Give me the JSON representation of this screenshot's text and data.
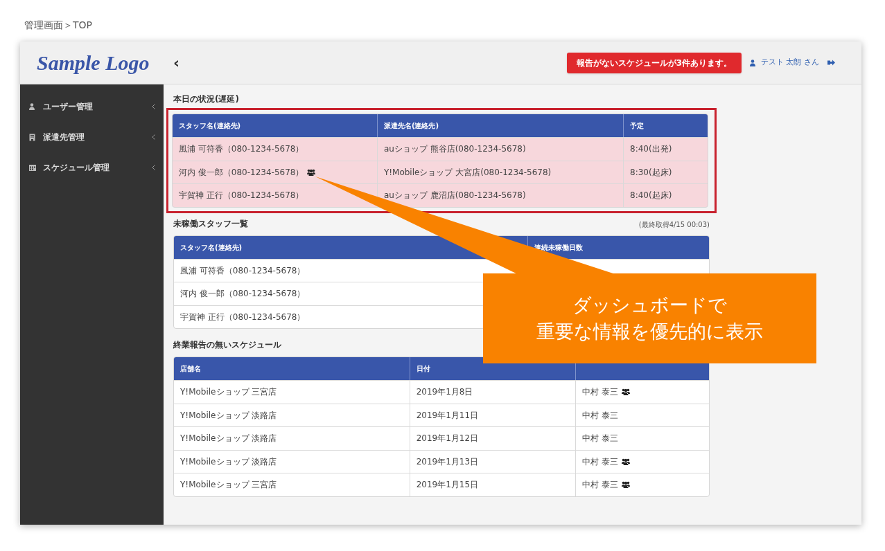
{
  "breadcrumb": "管理画面＞TOP",
  "header": {
    "logo": "Sample Logo",
    "toggle": "‹",
    "alert": "報告がないスケジュールが3件あります。",
    "user": "テスト 太朗 さん"
  },
  "sidebar": {
    "items": [
      {
        "label": "ユーザー管理"
      },
      {
        "label": "派遣先管理"
      },
      {
        "label": "スケジュール管理"
      }
    ]
  },
  "sections": [
    {
      "title": "本日の状況(遅延)",
      "highlighted": true,
      "tinted": true,
      "columns": [
        "スタッフ名(連絡先)",
        "派遣先名(連絡先)",
        "予定"
      ],
      "rows": [
        {
          "cells": [
            {
              "text": "風浦 可符香（080-1234-5678）"
            },
            {
              "text": "auショップ 熊谷店(080-1234-5678)"
            },
            {
              "text": "8:40(出発)"
            }
          ]
        },
        {
          "cells": [
            {
              "text": "河内 俊一郎（080-1234-5678）",
              "group": true
            },
            {
              "text": "Y!Mobileショップ 大宮店(080-1234-5678)"
            },
            {
              "text": "8:30(起床)"
            }
          ]
        },
        {
          "cells": [
            {
              "text": "宇賀神 正行（080-1234-5678）"
            },
            {
              "text": "auショップ 鹿沼店(080-1234-5678)"
            },
            {
              "text": "8:40(起床)"
            }
          ]
        }
      ]
    },
    {
      "title": "未稼働スタッフ一覧",
      "note": "(最終取得4/15 00:03)",
      "highlighted": false,
      "tinted": false,
      "columns": [
        "スタッフ名(連絡先)",
        "連続未稼働日数"
      ],
      "rows": [
        {
          "cells": [
            {
              "text": "風浦 可符香（080-1234-5678）"
            }
          ]
        },
        {
          "cells": [
            {
              "text": "河内 俊一郎（080-1234-5678）"
            }
          ]
        },
        {
          "cells": [
            {
              "text": "宇賀神 正行（080-1234-5678）"
            }
          ]
        }
      ]
    },
    {
      "title": "終業報告の無いスケジュール",
      "highlighted": false,
      "tinted": false,
      "columns": [
        "店舗名",
        "日付",
        ""
      ],
      "rows": [
        {
          "cells": [
            {
              "text": "Y!Mobileショップ 三宮店"
            },
            {
              "text": "2019年1月8日"
            },
            {
              "text": "中村 泰三",
              "group": true
            }
          ]
        },
        {
          "cells": [
            {
              "text": "Y!Mobileショップ 淡路店"
            },
            {
              "text": "2019年1月11日"
            },
            {
              "text": "中村 泰三"
            }
          ]
        },
        {
          "cells": [
            {
              "text": "Y!Mobileショップ 淡路店"
            },
            {
              "text": "2019年1月12日"
            },
            {
              "text": "中村 泰三"
            }
          ]
        },
        {
          "cells": [
            {
              "text": "Y!Mobileショップ 淡路店"
            },
            {
              "text": "2019年1月13日"
            },
            {
              "text": "中村 泰三",
              "group": true
            }
          ]
        },
        {
          "cells": [
            {
              "text": "Y!Mobileショップ 三宮店"
            },
            {
              "text": "2019年1月15日"
            },
            {
              "text": "中村 泰三",
              "group": true
            }
          ]
        }
      ]
    }
  ],
  "callout": [
    "ダッシュボードで",
    "重要な情報を優先的に表示"
  ]
}
